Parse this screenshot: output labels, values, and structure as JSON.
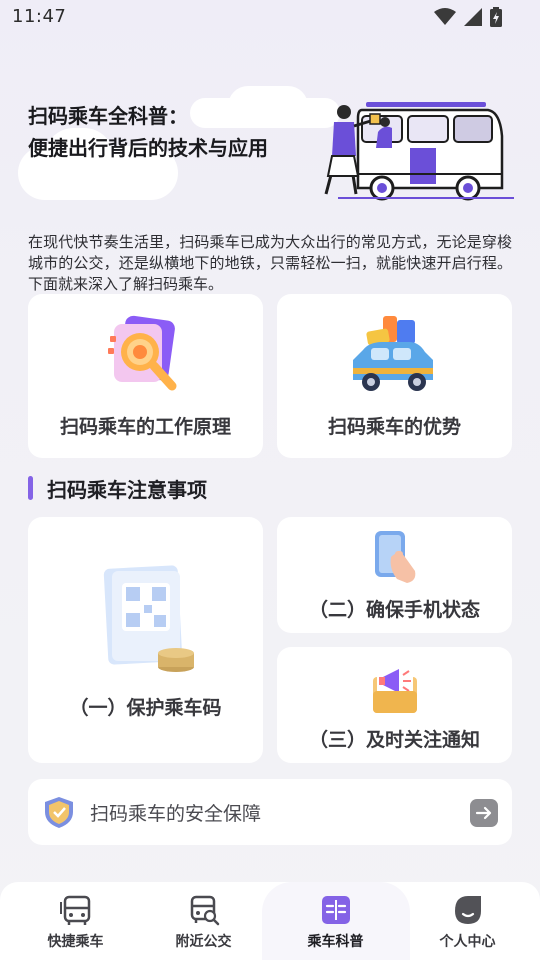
{
  "status_bar": {
    "time": "11:47"
  },
  "hero": {
    "title_line1": "扫码乘车全科普：",
    "title_line2": "便捷出行背后的技术与应用"
  },
  "intro": "在现代快节奏生活里，扫码乘车已成为大众出行的常见方式，无论是穿梭城市的公交，还是纵横地下的地铁，只需轻松一扫，就能快速开启行程。下面就来深入了解扫码乘车。",
  "cards": {
    "principle": "扫码乘车的工作原理",
    "advantages": "扫码乘车的优势"
  },
  "section": {
    "title": "扫码乘车注意事项"
  },
  "notes": {
    "protect_code": "（一）保护乘车码",
    "phone_status": "（二）确保手机状态",
    "notifications": "（三）及时关注通知"
  },
  "safety": {
    "label": "扫码乘车的安全保障"
  },
  "tabs": [
    {
      "label": "快捷乘车",
      "icon": "bus-icon"
    },
    {
      "label": "附近公交",
      "icon": "bus-search-icon"
    },
    {
      "label": "乘车科普",
      "icon": "book-icon",
      "active": true
    },
    {
      "label": "个人中心",
      "icon": "profile-icon"
    }
  ],
  "colors": {
    "accent": "#8463e6",
    "card": "#ffffff",
    "background": "#f1f0f6"
  }
}
